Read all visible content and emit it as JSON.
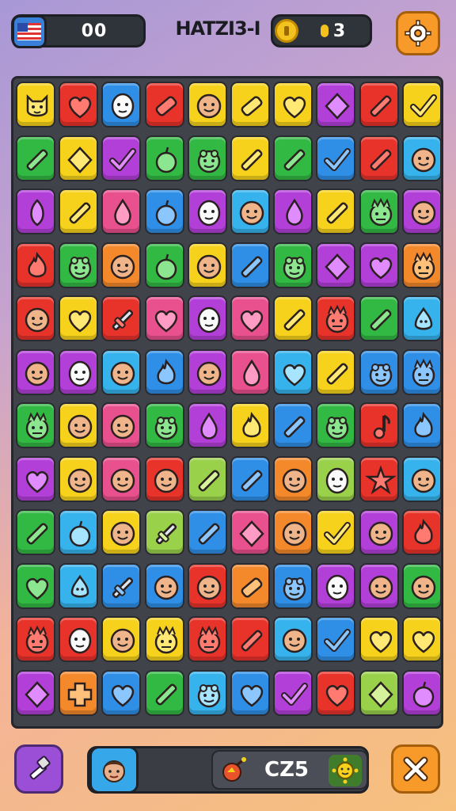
{
  "hud": {
    "flag_icon": "us-flag-icon",
    "left_counter": "00",
    "title": "HATZI3-I",
    "coin_icon": "coin-icon",
    "coin_counter": "3",
    "settings_icon": "gear-icon"
  },
  "footer": {
    "tool_icon": "hammer-icon",
    "avatar_icon": "player-face-icon",
    "booster_icon": "bomb-icon",
    "score": "CZ5",
    "sun_icon": "sun-icon",
    "close_icon": "close-icon"
  },
  "palette": {
    "Y": "#f6d21c",
    "R": "#e8332b",
    "B": "#2f8fe6",
    "P": "#b23fd8",
    "G": "#32b944",
    "O": "#f3892b",
    "K": "#e9508e",
    "L": "#9ad14b",
    "C": "#36b2ec"
  },
  "board": {
    "rows": [
      [
        [
          "Y",
          "cat-face"
        ],
        [
          "R",
          "heart"
        ],
        [
          "B",
          "mask-face"
        ],
        [
          "R",
          "candy"
        ],
        [
          "Y",
          "smiley-face"
        ],
        [
          "Y",
          "candy"
        ],
        [
          "Y",
          "heart"
        ],
        [
          "P",
          "diamond"
        ],
        [
          "R",
          "pencil"
        ],
        [
          "Y",
          "check"
        ]
      ],
      [
        [
          "G",
          "pencil"
        ],
        [
          "Y",
          "diamond"
        ],
        [
          "P",
          "check"
        ],
        [
          "G",
          "apple"
        ],
        [
          "G",
          "frog-face"
        ],
        [
          "Y",
          "pencil"
        ],
        [
          "G",
          "pencil"
        ],
        [
          "B",
          "check"
        ],
        [
          "R",
          "pencil"
        ],
        [
          "C",
          "smiley-face"
        ]
      ],
      [
        [
          "P",
          "leaf"
        ],
        [
          "Y",
          "pencil"
        ],
        [
          "K",
          "drop"
        ],
        [
          "B",
          "apple"
        ],
        [
          "P",
          "mask-face"
        ],
        [
          "C",
          "smiley-face"
        ],
        [
          "P",
          "drop"
        ],
        [
          "Y",
          "pencil"
        ],
        [
          "G",
          "monster-face"
        ],
        [
          "P",
          "smiley-face"
        ]
      ],
      [
        [
          "R",
          "flame"
        ],
        [
          "G",
          "frog-face"
        ],
        [
          "O",
          "smiley-face"
        ],
        [
          "G",
          "apple"
        ],
        [
          "Y",
          "smiley-face"
        ],
        [
          "B",
          "pencil"
        ],
        [
          "G",
          "frog-face"
        ],
        [
          "P",
          "diamond"
        ],
        [
          "P",
          "heart"
        ],
        [
          "O",
          "monster-face"
        ]
      ],
      [
        [
          "R",
          "smiley-face"
        ],
        [
          "Y",
          "heart"
        ],
        [
          "R",
          "sword"
        ],
        [
          "K",
          "heart"
        ],
        [
          "P",
          "mask-face"
        ],
        [
          "K",
          "heart"
        ],
        [
          "Y",
          "pencil"
        ],
        [
          "R",
          "monster-face"
        ],
        [
          "G",
          "pencil"
        ],
        [
          "C",
          "pear"
        ]
      ],
      [
        [
          "P",
          "smiley-face"
        ],
        [
          "P",
          "mask-face"
        ],
        [
          "C",
          "smiley-face"
        ],
        [
          "B",
          "flame"
        ],
        [
          "P",
          "smiley-face"
        ],
        [
          "K",
          "drop"
        ],
        [
          "C",
          "heart"
        ],
        [
          "Y",
          "pencil"
        ],
        [
          "B",
          "frog-face"
        ],
        [
          "B",
          "monster-face"
        ]
      ],
      [
        [
          "G",
          "monster-face"
        ],
        [
          "Y",
          "smiley-face"
        ],
        [
          "K",
          "smiley-face"
        ],
        [
          "G",
          "frog-face"
        ],
        [
          "P",
          "drop"
        ],
        [
          "Y",
          "flame"
        ],
        [
          "B",
          "pencil"
        ],
        [
          "G",
          "frog-face"
        ],
        [
          "R",
          "note"
        ],
        [
          "B",
          "flame"
        ]
      ],
      [
        [
          "P",
          "heart"
        ],
        [
          "Y",
          "smiley-face"
        ],
        [
          "K",
          "smiley-face"
        ],
        [
          "R",
          "smiley-face"
        ],
        [
          "L",
          "pencil"
        ],
        [
          "B",
          "pencil"
        ],
        [
          "O",
          "smiley-face"
        ],
        [
          "L",
          "mask-face"
        ],
        [
          "R",
          "star"
        ],
        [
          "C",
          "smiley-face"
        ]
      ],
      [
        [
          "G",
          "pencil"
        ],
        [
          "C",
          "apple"
        ],
        [
          "Y",
          "smiley-face"
        ],
        [
          "L",
          "sword"
        ],
        [
          "B",
          "pencil"
        ],
        [
          "K",
          "diamond"
        ],
        [
          "O",
          "smiley-face"
        ],
        [
          "Y",
          "check"
        ],
        [
          "P",
          "smiley-face"
        ],
        [
          "R",
          "flame"
        ]
      ],
      [
        [
          "G",
          "heart"
        ],
        [
          "C",
          "pear"
        ],
        [
          "B",
          "sword"
        ],
        [
          "B",
          "smiley-face"
        ],
        [
          "R",
          "smiley-face"
        ],
        [
          "O",
          "candy"
        ],
        [
          "B",
          "frog-face"
        ],
        [
          "P",
          "mask-face"
        ],
        [
          "P",
          "smiley-face"
        ],
        [
          "G",
          "smiley-face"
        ]
      ],
      [
        [
          "R",
          "monster-face"
        ],
        [
          "R",
          "mask-face"
        ],
        [
          "Y",
          "smiley-face"
        ],
        [
          "Y",
          "monster-face"
        ],
        [
          "R",
          "monster-face"
        ],
        [
          "R",
          "pencil"
        ],
        [
          "C",
          "smiley-face"
        ],
        [
          "B",
          "check"
        ],
        [
          "Y",
          "heart"
        ],
        [
          "Y",
          "heart"
        ]
      ],
      [
        [
          "P",
          "diamond"
        ],
        [
          "O",
          "cross"
        ],
        [
          "B",
          "heart"
        ],
        [
          "G",
          "pencil"
        ],
        [
          "C",
          "frog-face"
        ],
        [
          "B",
          "heart"
        ],
        [
          "P",
          "check"
        ],
        [
          "R",
          "heart"
        ],
        [
          "L",
          "diamond"
        ],
        [
          "P",
          "apple"
        ]
      ]
    ]
  }
}
